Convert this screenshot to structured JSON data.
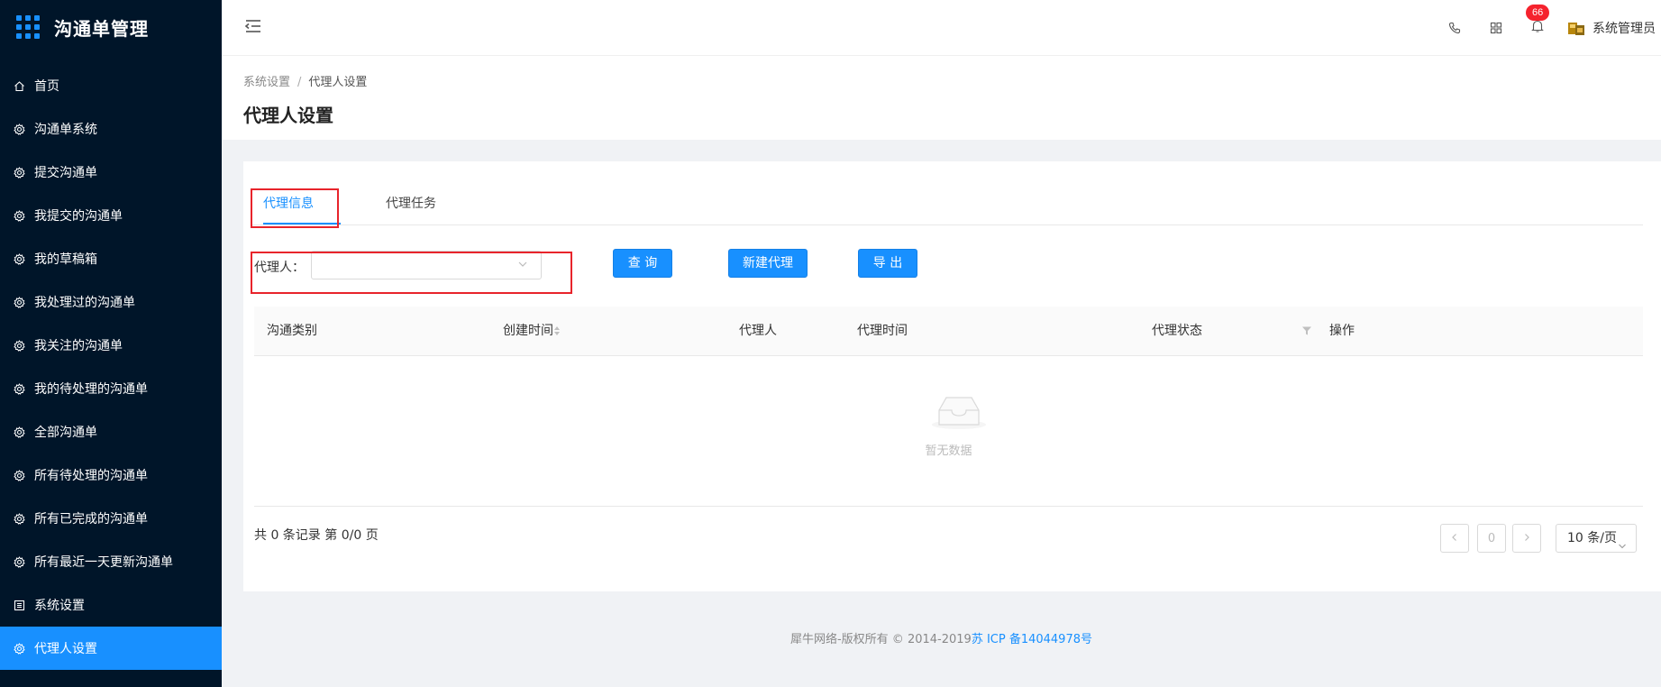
{
  "app": {
    "title": "沟通单管理"
  },
  "sidebar": {
    "items": [
      {
        "label": "首页",
        "icon": "home-icon"
      },
      {
        "label": "沟通单系统",
        "icon": "gear-icon"
      },
      {
        "label": "提交沟通单",
        "icon": "gear-icon"
      },
      {
        "label": "我提交的沟通单",
        "icon": "gear-icon"
      },
      {
        "label": "我的草稿箱",
        "icon": "gear-icon"
      },
      {
        "label": "我处理过的沟通单",
        "icon": "gear-icon"
      },
      {
        "label": "我关注的沟通单",
        "icon": "gear-icon"
      },
      {
        "label": "我的待处理的沟通单",
        "icon": "gear-icon"
      },
      {
        "label": "全部沟通单",
        "icon": "gear-icon"
      },
      {
        "label": "所有待处理的沟通单",
        "icon": "gear-icon"
      },
      {
        "label": "所有已完成的沟通单",
        "icon": "gear-icon"
      },
      {
        "label": "所有最近一天更新沟通单",
        "icon": "gear-icon"
      },
      {
        "label": "系统设置",
        "icon": "list-icon"
      },
      {
        "label": "代理人设置",
        "icon": "gear-icon",
        "active": true
      }
    ]
  },
  "header": {
    "notification_count": "66",
    "user_name": "系统管理员"
  },
  "breadcrumb": {
    "parent": "系统设置",
    "separator": "/",
    "current": "代理人设置"
  },
  "page_title": "代理人设置",
  "tabs": [
    {
      "label": "代理信息",
      "active": true
    },
    {
      "label": "代理任务"
    }
  ],
  "filter": {
    "label": "代理人：",
    "value": ""
  },
  "buttons": {
    "query": "查 询",
    "new": "新建代理",
    "export": "导 出"
  },
  "table": {
    "columns": [
      "沟通类别",
      "创建时间",
      "代理人",
      "代理时间",
      "代理状态",
      "操作"
    ],
    "rows": [],
    "empty_text": "暂无数据"
  },
  "pagination": {
    "summary": "共 0 条记录 第 0/0 页",
    "current_page": "0",
    "page_size": "10 条/页"
  },
  "footer": {
    "text": "犀牛网络-版权所有 © 2014-2019",
    "icp": "苏 ICP 备14044978号"
  },
  "colors": {
    "sidebar_bg": "#001529",
    "primary": "#1890ff",
    "highlight_box": "#e8242b",
    "badge": "#f5222d"
  }
}
